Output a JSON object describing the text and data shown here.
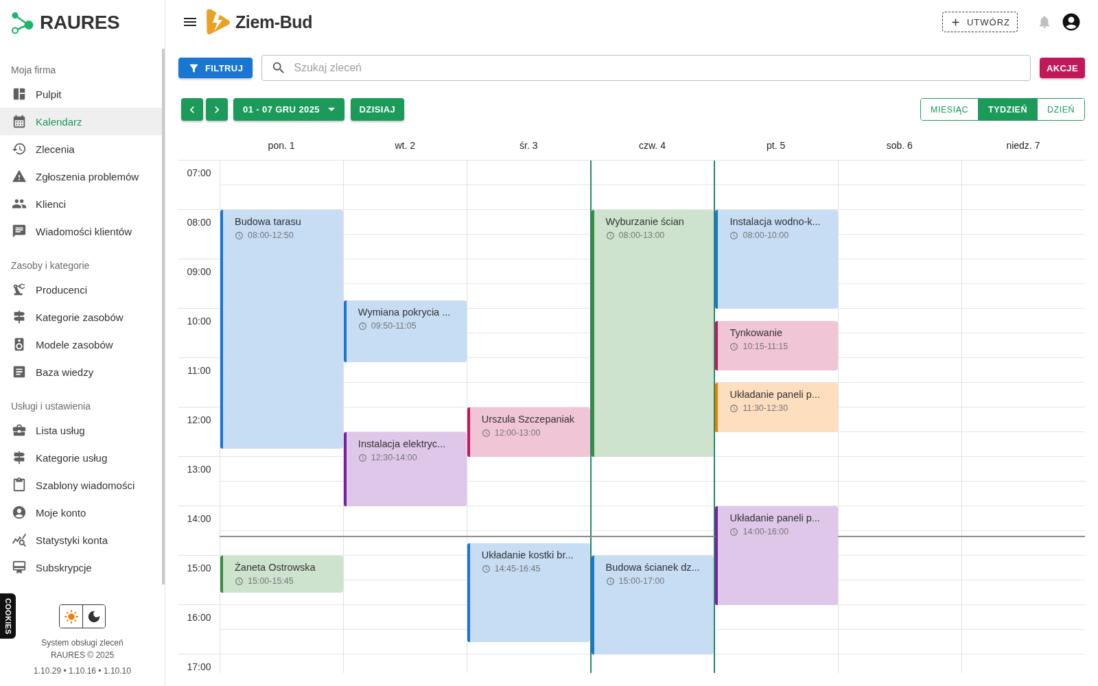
{
  "sidebar": {
    "brand": "RAURES",
    "sections": [
      {
        "title": "Moja firma",
        "items": [
          {
            "label": "Pulpit",
            "selected": false
          },
          {
            "label": "Kalendarz",
            "selected": true
          },
          {
            "label": "Zlecenia",
            "selected": false
          },
          {
            "label": "Zgłoszenia problemów",
            "selected": false
          },
          {
            "label": "Klienci",
            "selected": false
          },
          {
            "label": "Wiadomości klientów",
            "selected": false
          }
        ]
      },
      {
        "title": "Zasoby i kategorie",
        "items": [
          {
            "label": "Producenci",
            "selected": false
          },
          {
            "label": "Kategorie zasobów",
            "selected": false
          },
          {
            "label": "Modele zasobów",
            "selected": false
          },
          {
            "label": "Baza wiedzy",
            "selected": false
          }
        ]
      },
      {
        "title": "Usługi i ustawienia",
        "items": [
          {
            "label": "Lista usług",
            "selected": false
          },
          {
            "label": "Kategorie usług",
            "selected": false
          },
          {
            "label": "Szablony wiadomości",
            "selected": false
          },
          {
            "label": "Moje konto",
            "selected": false
          },
          {
            "label": "Statystyki konta",
            "selected": false
          },
          {
            "label": "Subskrypcje",
            "selected": false
          }
        ]
      }
    ],
    "theme_toggle": [
      {
        "kind": "light",
        "selected": true
      },
      {
        "kind": "dark",
        "selected": false
      }
    ],
    "footer": [
      "System obsługi zleceń",
      "RAURES © 2025",
      "1.10.29 • 1.10.16 • 1.10.10"
    ]
  },
  "cookies_tab": {
    "label": "COOKIES"
  },
  "header": {
    "company": "Ziem-Bud",
    "create_button": "UTWÓRZ"
  },
  "toolbar": {
    "filter_button": "FILTRUJ",
    "search": {
      "placeholder": "Szukaj zleceń"
    },
    "actions_button": "AKCJE"
  },
  "calendar_nav": {
    "range": "01 - 07 GRU 2025",
    "today_button": "DZISIAJ",
    "views": [
      {
        "label": "MIESIĄC",
        "selected": false
      },
      {
        "label": "TYDZIEŃ",
        "selected": true
      },
      {
        "label": "DZIEŃ",
        "selected": false
      }
    ]
  },
  "calendar": {
    "hours": [
      "07:00",
      "08:00",
      "09:00",
      "10:00",
      "11:00",
      "12:00",
      "13:00",
      "14:00",
      "15:00",
      "16:00",
      "17:00"
    ],
    "days": [
      {
        "label": "pon. 1",
        "today": false,
        "events": [
          {
            "title": "Budowa tarasu",
            "time": "08:00-12:50",
            "color": "#1976d2"
          },
          {
            "title": "Żaneta Ostrowska",
            "time": "15:00-15:45",
            "color": "#388e3c"
          }
        ]
      },
      {
        "label": "wt. 2",
        "today": false,
        "events": [
          {
            "title": "Wymiana pokrycia ...",
            "time": "09:50-11:05",
            "color": "#1976d2"
          },
          {
            "title": "Instalacja elektryc...",
            "time": "12:30-14:00",
            "color": "#7b1fa2"
          }
        ]
      },
      {
        "label": "śr. 3",
        "today": false,
        "events": [
          {
            "title": "Urszula Szczepaniak",
            "time": "12:00-13:00",
            "color": "#c2185b"
          },
          {
            "title": "Układanie kostki br...",
            "time": "14:45-16:45",
            "color": "#1976d2"
          }
        ]
      },
      {
        "label": "czw. 4",
        "today": true,
        "events": [
          {
            "title": "Wyburzanie ścian",
            "time": "08:00-13:00",
            "color": "#388e3c"
          },
          {
            "title": "Budowa ścianek dz...",
            "time": "15:00-17:00",
            "color": "#1976d2"
          }
        ]
      },
      {
        "label": "pt. 5",
        "today": false,
        "events": [
          {
            "title": "Instalacja wodno-k...",
            "time": "08:00-10:00",
            "color": "#1976d2"
          },
          {
            "title": "Tynkowanie",
            "time": "10:15-11:15",
            "color": "#c2185b"
          },
          {
            "title": "Układanie paneli p...",
            "time": "11:30-12:30",
            "color": "#f57c00"
          },
          {
            "title": "Układanie paneli p...",
            "time": "14:00-16:00",
            "color": "#7b1fa2"
          }
        ]
      },
      {
        "label": "sob. 6",
        "today": false
      },
      {
        "label": "niedz. 7",
        "today": false
      }
    ]
  }
}
